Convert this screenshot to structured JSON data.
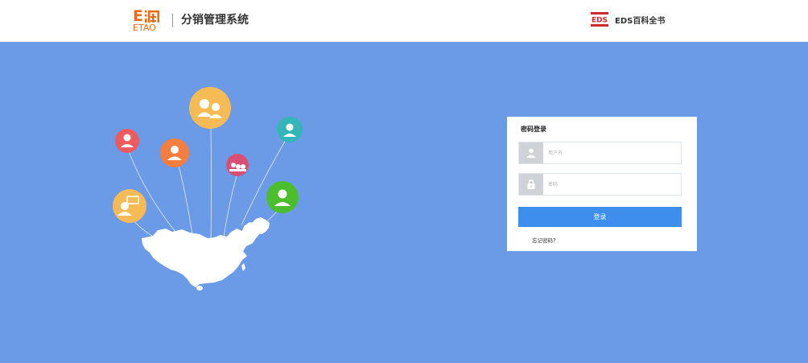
{
  "header": {
    "logo": {
      "mark": "E淘",
      "sub": "ETAO"
    },
    "system_title": "分销管理系统",
    "brand": {
      "logo_text": "EDS",
      "name": "EDS百科全书"
    }
  },
  "colors": {
    "background": "#6b9ae6",
    "logo_orange": "#ef6a12",
    "button_blue": "#3e8eee",
    "brand_red": "#d8262d"
  },
  "illustration": {
    "map": "china-map-silhouette",
    "bubbles": [
      {
        "icon": "group-icon",
        "color": "#f7bb55"
      },
      {
        "icon": "user-icon",
        "color": "#ef5a5f"
      },
      {
        "icon": "user-icon",
        "color": "#f57e3e"
      },
      {
        "icon": "chat-user-icon",
        "color": "#f7bb55"
      },
      {
        "icon": "people-chat-icon",
        "color": "#d84f73"
      },
      {
        "icon": "user-icon",
        "color": "#34b6b8"
      },
      {
        "icon": "user-icon",
        "color": "#4cbe2e"
      }
    ]
  },
  "login": {
    "title": "密码登录",
    "username": {
      "placeholder": "用户名",
      "icon": "user-icon"
    },
    "password": {
      "placeholder": "密码",
      "icon": "lock-icon"
    },
    "submit_label": "登录",
    "forgot_label": "忘记密码？"
  }
}
